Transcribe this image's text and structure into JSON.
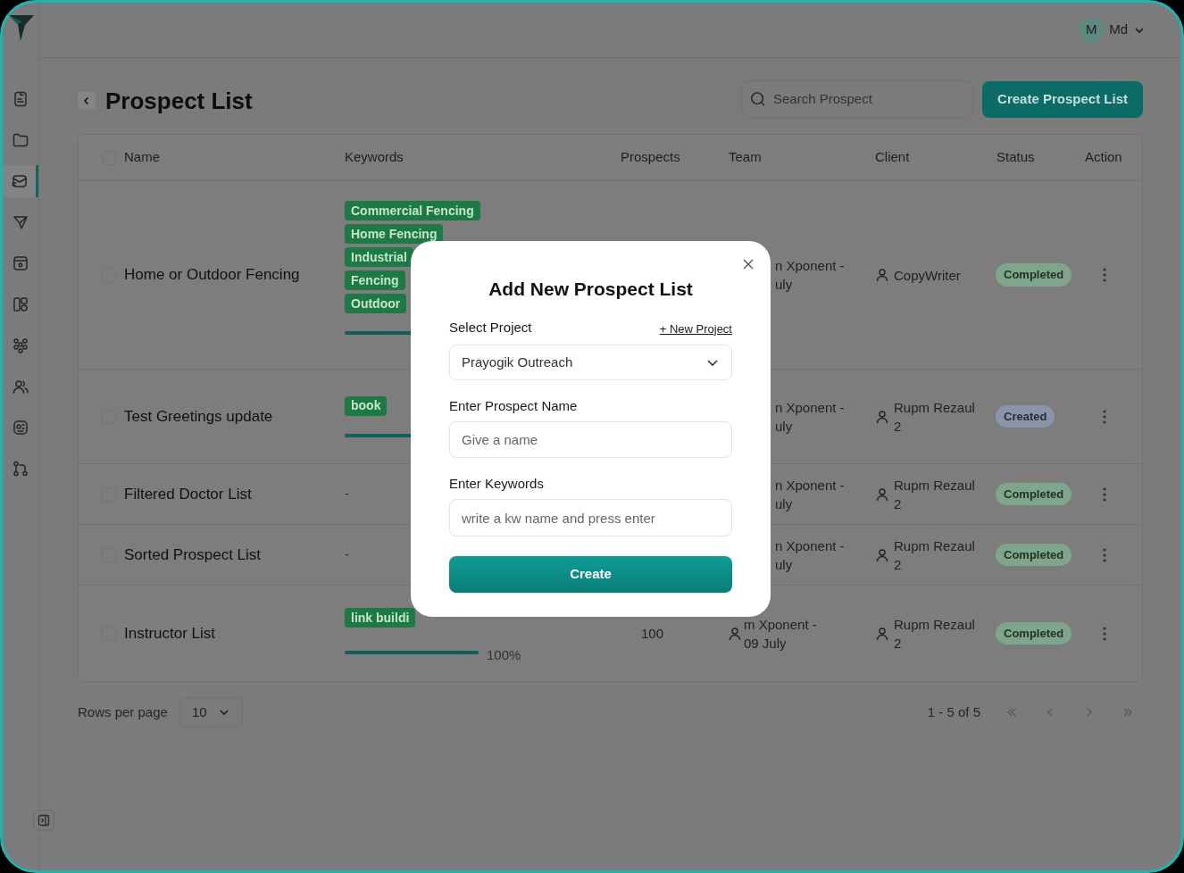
{
  "sidebar": {
    "items": [
      {
        "kind": "document",
        "selected": false
      },
      {
        "kind": "folder",
        "selected": false
      },
      {
        "kind": "mail",
        "selected": true
      },
      {
        "kind": "send",
        "selected": false
      },
      {
        "kind": "calendar",
        "selected": false
      },
      {
        "kind": "layout",
        "selected": false
      },
      {
        "kind": "group",
        "selected": false
      },
      {
        "kind": "users",
        "selected": false
      },
      {
        "kind": "target",
        "selected": false
      },
      {
        "kind": "branch",
        "selected": false
      }
    ]
  },
  "user": {
    "initial": "M",
    "name": "Md"
  },
  "page": {
    "title": "Prospect List",
    "search": {
      "placeholder": "Search Prospect"
    },
    "create_button": "Create Prospect List"
  },
  "table": {
    "select_all_checked": false,
    "columns": [
      "Name",
      "Keywords",
      "Prospects",
      "Team",
      "Client",
      "Status",
      "Action"
    ],
    "rows": [
      {
        "checked": false,
        "name": "Home or Outdoor Fencing",
        "keywords": [
          "Commercial Fencing",
          "Home Fencing",
          "Industrial",
          "Fencing",
          "Outdoor"
        ],
        "progress": {
          "level": 1
        },
        "team": [
          "n Xponent -",
          "uly"
        ],
        "team_icon": false,
        "client": "CopyWriter",
        "status": "Completed",
        "color": "#7fa58a"
      },
      {
        "checked": false,
        "name": "Test Greetings update",
        "keywords": [
          "book"
        ],
        "progress": {
          "level": 1
        },
        "team": [
          "n Xponent -",
          "uly"
        ],
        "team_icon": false,
        "client": "Rupm Rezaul 2",
        "status": "Created",
        "color": "#8a95ab"
      },
      {
        "checked": false,
        "name": "Filtered Doctor List",
        "keywords_text": "-",
        "team": [
          "n Xponent -",
          "uly"
        ],
        "team_icon": false,
        "client": "Rupm Rezaul 2",
        "status": "Completed",
        "color": "#7fa58a"
      },
      {
        "checked": false,
        "name": "Sorted Prospect List",
        "keywords_text": "-",
        "team": [
          "n Xponent -",
          "uly"
        ],
        "team_icon": false,
        "client": "Rupm Rezaul 2",
        "status": "Completed",
        "color": "#7fa58a"
      },
      {
        "checked": false,
        "name": "Instructor List",
        "keywords": [
          "link buildi"
        ],
        "progress": {
          "level": 1,
          "reading": "100%"
        },
        "prospects": "100",
        "team": [
          "m Xponent -",
          "09 July"
        ],
        "team_icon": true,
        "client": "Rupm Rezaul 2",
        "status": "Completed",
        "color": "#7fa58a"
      }
    ]
  },
  "footer": {
    "rows_label": "Rows per page",
    "rows_value": "10",
    "range": "1 - 5 of 5",
    "pager": [
      {
        "kind": "first",
        "disabled": true
      },
      {
        "kind": "prev",
        "disabled": true
      },
      {
        "kind": "next",
        "disabled": true
      },
      {
        "kind": "last",
        "disabled": true
      }
    ]
  },
  "modal": {
    "title": "Add New Prospect List",
    "project_label": "Select Project",
    "new_project_link": "+ New Project",
    "project_value": "Prayogik Outreach",
    "name_label": "Enter Prospect Name",
    "name_placeholder": "Give a name",
    "keywords_label": "Enter Keywords",
    "keywords_placeholder": "write a kw name and press enter",
    "submit": "Create"
  }
}
